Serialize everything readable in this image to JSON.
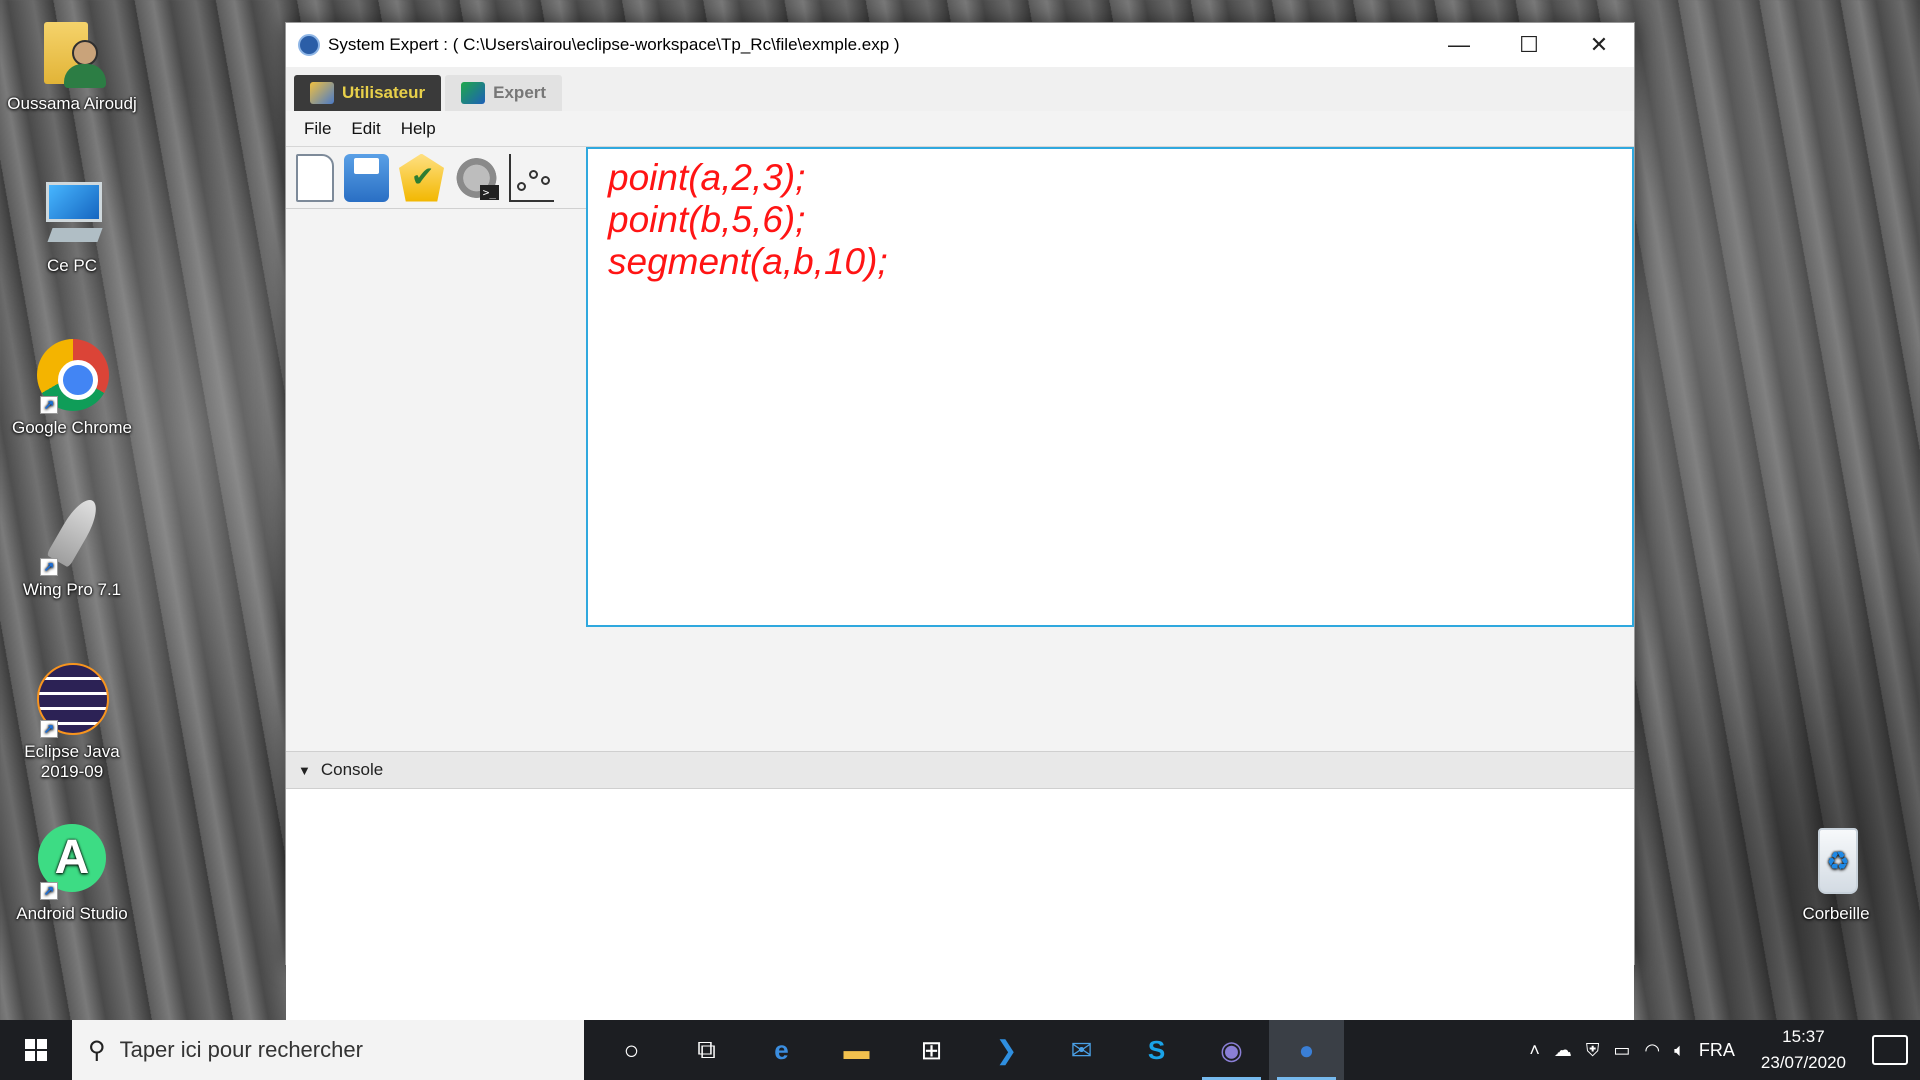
{
  "desktop": {
    "icons": [
      {
        "label": "Oussama Airoudj",
        "icon": "user-folder-icon"
      },
      {
        "label": "Ce PC",
        "icon": "computer-icon"
      },
      {
        "label": "Google Chrome",
        "icon": "chrome-icon"
      },
      {
        "label": "Wing Pro 7.1",
        "icon": "wing-icon"
      },
      {
        "label": "Eclipse Java 2019-09",
        "icon": "eclipse-icon"
      },
      {
        "label": "Android Studio",
        "icon": "android-studio-icon"
      },
      {
        "label": "Corbeille",
        "icon": "recycle-bin-icon"
      }
    ]
  },
  "window": {
    "title": "System Expert : ( C:\\Users\\airou\\eclipse-workspace\\Tp_Rc\\file\\exmple.exp )",
    "controls": {
      "minimize": "—",
      "maximize": "☐",
      "close": "✕"
    },
    "tabs": [
      {
        "label": "Utilisateur",
        "active": true
      },
      {
        "label": "Expert",
        "active": false
      }
    ],
    "menu": [
      "File",
      "Edit",
      "Help"
    ],
    "toolbar": [
      "new-file-icon",
      "save-icon",
      "check-icon",
      "run-console-icon",
      "graph-icon"
    ],
    "editor": {
      "lines": [
        "point(a,2,3);",
        "point(b,5,6);",
        "segment(a,b,10);"
      ],
      "text_color": "#ff1414"
    },
    "console": {
      "label": "Console",
      "content": ""
    }
  },
  "taskbar": {
    "search_placeholder": "Taper ici pour rechercher",
    "apps": [
      "cortana-icon",
      "task-view-icon",
      "edge-icon",
      "file-explorer-icon",
      "store-icon",
      "vscode-icon",
      "mail-icon",
      "skype-icon",
      "eclipse-icon",
      "system-expert-icon"
    ],
    "language": "FRA",
    "time": "15:37",
    "date": "23/07/2020"
  },
  "colors": {
    "accent": "#2fa8de",
    "active_tab_bg": "#3a3a3a",
    "active_tab_text": "#e8d04a"
  }
}
